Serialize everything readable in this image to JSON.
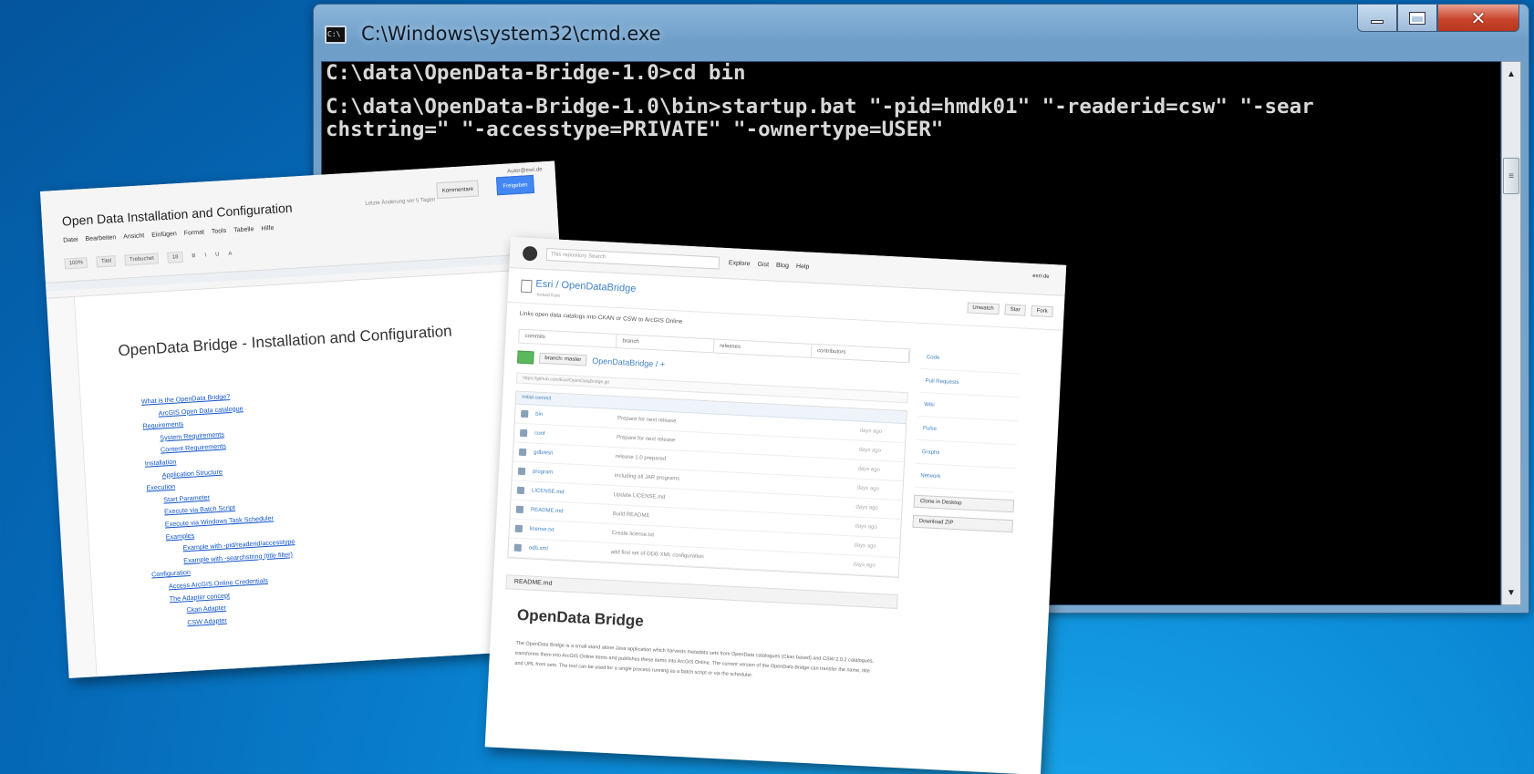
{
  "cmd": {
    "title": "C:\\Windows\\system32\\cmd.exe",
    "lines": [
      "C:\\data\\OpenData-Bridge-1.0>cd bin",
      "",
      "C:\\data\\OpenData-Bridge-1.0\\bin>startup.bat \"-pid=hmdk01\" \"-readerid=csw\" \"-sear",
      "chstring=\" \"-accesstype=PRIVATE\" \"-ownertype=USER\""
    ]
  },
  "gdoc": {
    "title": "Open Data Installation and Configuration",
    "status": "Letzte Änderung vor 5 Tagen",
    "user": "Autor@esri.de",
    "comments_label": "Kommentare",
    "share_label": "Freigeben",
    "menu": [
      "Datei",
      "Bearbeiten",
      "Ansicht",
      "Einfügen",
      "Format",
      "Tools",
      "Tabelle",
      "Hilfe"
    ],
    "toolbar": [
      "100%",
      "Titel",
      "Trebuchet",
      "18",
      "B",
      "I",
      "U",
      "A"
    ],
    "heading": "OpenData Bridge - Installation and Configuration",
    "toc": [
      {
        "text": "What is the OpenData Bridge?",
        "level": 0
      },
      {
        "text": "ArcGIS Open Data catalogue",
        "level": 1
      },
      {
        "text": "Requirements",
        "level": 0
      },
      {
        "text": "System Requirements",
        "level": 1
      },
      {
        "text": "Content Requirements",
        "level": 1
      },
      {
        "text": "Installation",
        "level": 0
      },
      {
        "text": "Application Structure",
        "level": 1
      },
      {
        "text": "Execution",
        "level": 0
      },
      {
        "text": "Start Parameter",
        "level": 1
      },
      {
        "text": "Execute via Batch Script",
        "level": 1
      },
      {
        "text": "Execute via Windows Task Scheduler",
        "level": 1
      },
      {
        "text": "Examples",
        "level": 1
      },
      {
        "text": "Example with -pid/readerid/accesstype",
        "level": 2
      },
      {
        "text": "Example with -searchstring (title filter)",
        "level": 2
      },
      {
        "text": "Configuration",
        "level": 0
      },
      {
        "text": "Access ArcGIS Online Credentials",
        "level": 1
      },
      {
        "text": "The Adapter concept",
        "level": 1
      },
      {
        "text": "Ckan Adapter",
        "level": 2
      },
      {
        "text": "CSW Adapter",
        "level": 2
      }
    ]
  },
  "github": {
    "search_placeholder": "This repository  Search",
    "nav": [
      "Explore",
      "Gist",
      "Blog",
      "Help"
    ],
    "user": "esri-de",
    "repo": "Esri / OpenDataBridge",
    "repo_sub": "forked from",
    "actions": [
      "Unwatch",
      "Star",
      "Fork"
    ],
    "description": "Links open data catalogs into CKAN or CSW to ArcGIS Online",
    "stats": [
      "commits",
      "branch",
      "releases",
      "contributors"
    ],
    "branch": "branch: master",
    "crumb": "OpenDataBridge / +",
    "clone": "https://github.com/Esri/OpenDataBridge.git",
    "commit": "Initial commit",
    "files": [
      {
        "name": "bin",
        "msg": "Prepare for next release",
        "age": "days ago"
      },
      {
        "name": "conf",
        "msg": "Prepare for next release",
        "age": "days ago"
      },
      {
        "name": "gdb/esri",
        "msg": "release 1.0 prepared",
        "age": "days ago"
      },
      {
        "name": "program",
        "msg": "including all JAR programs",
        "age": "days ago"
      },
      {
        "name": "LICENSE.md",
        "msg": "Update LICENSE.md",
        "age": "days ago"
      },
      {
        "name": "README.md",
        "msg": "Build README",
        "age": "days ago"
      },
      {
        "name": "license.txt",
        "msg": "Create license.txt",
        "age": "days ago"
      },
      {
        "name": "odb.xml",
        "msg": "add first set of ODB XML configuration",
        "age": "days ago"
      }
    ],
    "side": [
      "Code",
      "Pull Requests",
      "Wiki",
      "Pulse",
      "Graphs",
      "Network"
    ],
    "side_buttons": [
      "Clone in Desktop",
      "Download ZIP"
    ],
    "readme_label": "README.md",
    "readme_title": "OpenData Bridge",
    "readme_text": "The OpenData Bridge is a small stand alone Java application which harvests metadata sets from OpenData catalogues (Ckan based) and CSW 2.0.2 catalogues, transforms them into ArcGIS Online items and publishes these items into ArcGIS Online. The current version of the OpenData Bridge can transfer the name, title and URL from sets. The tool can be used for a single process running as a batch script or via the scheduler."
  }
}
